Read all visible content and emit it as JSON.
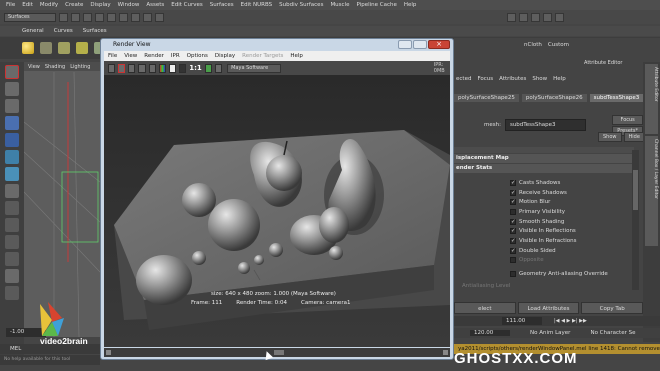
{
  "menubar": {
    "items": [
      "File",
      "Edit",
      "Modify",
      "Create",
      "Display",
      "Window",
      "Assets",
      "Edit Curves",
      "Surfaces",
      "Edit NURBS",
      "Subdiv Surfaces",
      "Muscle",
      "Pipeline Cache",
      "Help"
    ]
  },
  "status": {
    "menuset": "Surfaces"
  },
  "shelf": {
    "tabs": [
      "General",
      "Curves",
      "Surfaces"
    ]
  },
  "viewport": {
    "menu": [
      "View",
      "Shading",
      "Lighting"
    ]
  },
  "render_view": {
    "title": "Render View",
    "menu": [
      "File",
      "View",
      "Render",
      "IPR",
      "Options",
      "Display",
      "Render Targets",
      "Help"
    ],
    "scale": "1:1",
    "renderer": "Maya Software",
    "ipr_label": "IPR: 0MB",
    "status_line1": "size: 640 x 480  zoom: 1.000     (Maya Software)",
    "frame": "Frame: 111",
    "render_time": "Render Time: 0:04",
    "camera": "Camera: camera1"
  },
  "attribute_editor": {
    "vertical_tabs": [
      "Attribute Editor",
      "Channel Box / Layer Editor"
    ],
    "title": "Attribute Editor",
    "menu": [
      "ected",
      "Focus",
      "Attributes",
      "Show",
      "Help"
    ],
    "tabs": [
      "polySurfaceShape25",
      "polySurfaceShape26",
      "subdTessShape3"
    ],
    "mesh_label": "mesh:",
    "mesh_value": "subdTessShape3",
    "focus_label": "Focus",
    "presets_label": "Presets*",
    "show_label": "Show",
    "hide_label": "Hide",
    "sections": [
      "isplacement Map",
      "ender Stats"
    ],
    "checks": [
      {
        "label": "Casts Shadows",
        "checked": true,
        "dim": false
      },
      {
        "label": "Receive Shadows",
        "checked": true,
        "dim": false
      },
      {
        "label": "Motion Blur",
        "checked": true,
        "dim": false
      },
      {
        "label": "Primary Visibility",
        "checked": false,
        "dim": false
      },
      {
        "label": "Smooth Shading",
        "checked": true,
        "dim": false
      },
      {
        "label": "Visible In Reflections",
        "checked": true,
        "dim": false
      },
      {
        "label": "Visible In Refractions",
        "checked": true,
        "dim": false
      },
      {
        "label": "Double Sided",
        "checked": true,
        "dim": false
      },
      {
        "label": "Opposite",
        "checked": false,
        "dim": true
      }
    ],
    "geom_aa": "Geometry Anti-aliasing Override",
    "aa_level": "Antialiasing Level",
    "bottom_buttons": [
      "elect",
      "Load Attributes",
      "Copy Tab"
    ]
  },
  "timeline": {
    "range_start": "-1.00",
    "current_frame": "111.00",
    "range_end": "120.00",
    "anim_layer": "No Anim Layer",
    "character_set": "No Character Se"
  },
  "command": {
    "mel": "MEL",
    "help": "No help available for this tool",
    "error": "ya2011/scripts/others/renderWindowPanel.mel line 1418: Cannot remove t"
  },
  "branding": {
    "logo": "video2brain",
    "watermark": "GHOSTXX.COM"
  }
}
